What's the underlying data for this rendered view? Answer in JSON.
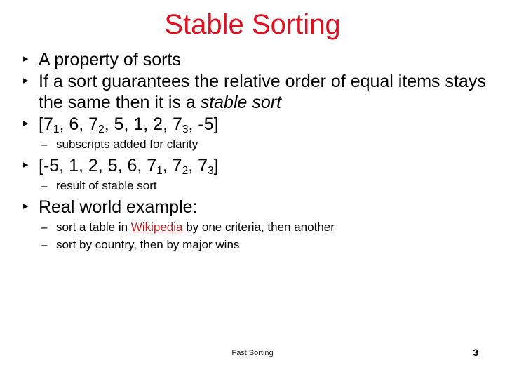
{
  "slide": {
    "title": "Stable Sorting",
    "title_color": "#e01020",
    "bullet_marker": "▸",
    "subbullet_marker": "–",
    "bullets": {
      "b1": "A property of sorts",
      "b2_part1": "If a sort guarantees the relative order of equal items stays the same then it is a ",
      "b2_italic": "stable sort",
      "b3_prefix": "[7",
      "b3_sub1": "1",
      "b3_mid1": ", 6, 7",
      "b3_sub2": "2",
      "b3_mid2": ", 5, 1, 2, 7",
      "b3_sub3": "3",
      "b3_suffix": ", -5]",
      "b3_sub_note": "subscripts added for clarity",
      "b4_prefix": "[-5, 1, 2, 5, 6, 7",
      "b4_sub1": "1",
      "b4_mid1": ", 7",
      "b4_sub2": "2",
      "b4_mid2": ", 7",
      "b4_sub3": "3",
      "b4_suffix": "]",
      "b4_sub_note": "result of stable sort",
      "b5": "Real world example:",
      "b5_sub1_before": "sort a table in ",
      "b5_sub1_link": "Wikipedia ",
      "b5_sub1_after": "by one criteria, then another",
      "b5_sub2": "sort by country, then by major wins"
    },
    "link_color": "#b41d20"
  },
  "footer": {
    "text": "Fast Sorting",
    "page_number": "3"
  }
}
